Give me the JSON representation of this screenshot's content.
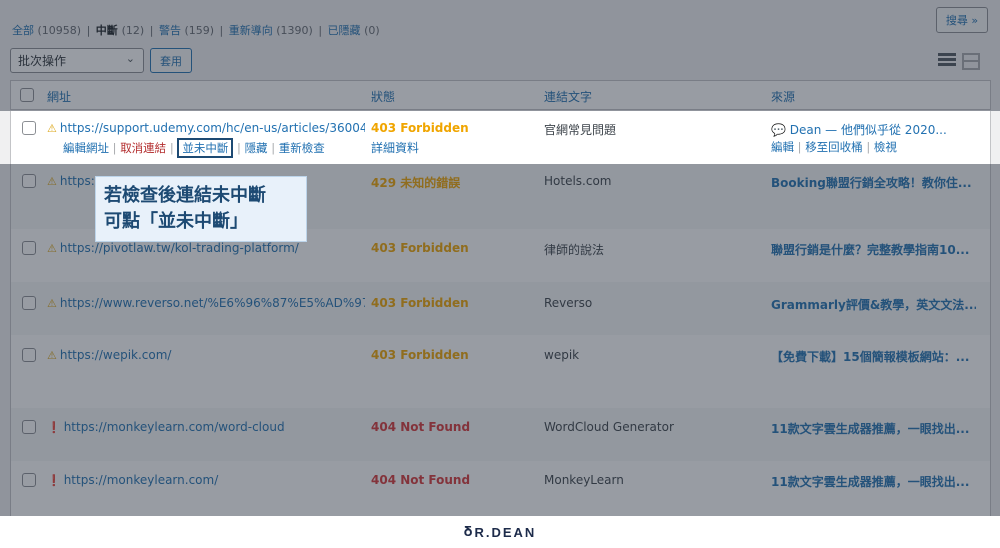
{
  "filters": {
    "all_label": "全部",
    "all_count": "(10958)",
    "broken_label": "中斷",
    "broken_count": "(12)",
    "warning_label": "警告",
    "warning_count": "(159)",
    "redirect_label": "重新導向",
    "redirect_count": "(1390)",
    "hidden_label": "已隱藏",
    "hidden_count": "(0)",
    "separator": "|"
  },
  "toolbar": {
    "search_label": "搜尋 »",
    "bulk_actions_value": "批次操作",
    "apply_label": "套用"
  },
  "columns": {
    "url": "網址",
    "status": "狀態",
    "link_text": "連結文字",
    "source": "來源"
  },
  "rows": [
    {
      "url": "https://support.udemy.com/hc/en-us/articles/360041...",
      "icon": "warning-icon",
      "status": "403 Forbidden",
      "status_detail": "詳細資料",
      "link_text": "官網常見問題",
      "source": "Dean — 他們似乎從 2020...",
      "source_icon": "comment-icon",
      "actions": [
        "編輯網址",
        "取消連結",
        "並未中斷",
        "隱藏",
        "重新檢查"
      ],
      "source_actions": [
        "編輯",
        "移至回收桶",
        "檢視"
      ]
    },
    {
      "url": "https://",
      "icon": "warning-icon",
      "status": "429 未知的錯誤",
      "link_text": "Hotels.com",
      "source": "Booking聯盟行銷全攻略！教你住..."
    },
    {
      "url": "https://pivotlaw.tw/kol-trading-platform/",
      "icon": "warning-icon",
      "status": "403 Forbidden",
      "link_text": "律師的說法",
      "source": "聯盟行銷是什麼？完整教學指南10..."
    },
    {
      "url": "https://www.reverso.net/%E6%96%87%E5%AD%97%...",
      "icon": "warning-icon",
      "status": "403 Forbidden",
      "link_text": "Reverso",
      "source": "Grammarly評價&教學，英文文法..."
    },
    {
      "url": "https://wepik.com/",
      "icon": "warning-icon",
      "status": "403 Forbidden",
      "link_text": "wepik",
      "source": "【免費下載】15個簡報模板網站：..."
    },
    {
      "url": "https://monkeylearn.com/word-cloud",
      "icon": "error-icon",
      "status": "404 Not Found",
      "link_text": "WordCloud Generator",
      "source": "11款文字雲生成器推薦，一眼找出..."
    },
    {
      "url": "https://monkeylearn.com/",
      "icon": "error-icon",
      "status": "404 Not Found",
      "link_text": "MonkeyLearn",
      "source": "11款文字雲生成器推薦，一眼找出..."
    }
  ],
  "callout": {
    "line1": "若檢查後連結未中斷",
    "line2": "可點「並未中斷」"
  },
  "footer": {
    "logo_text": "R.DEAN"
  }
}
